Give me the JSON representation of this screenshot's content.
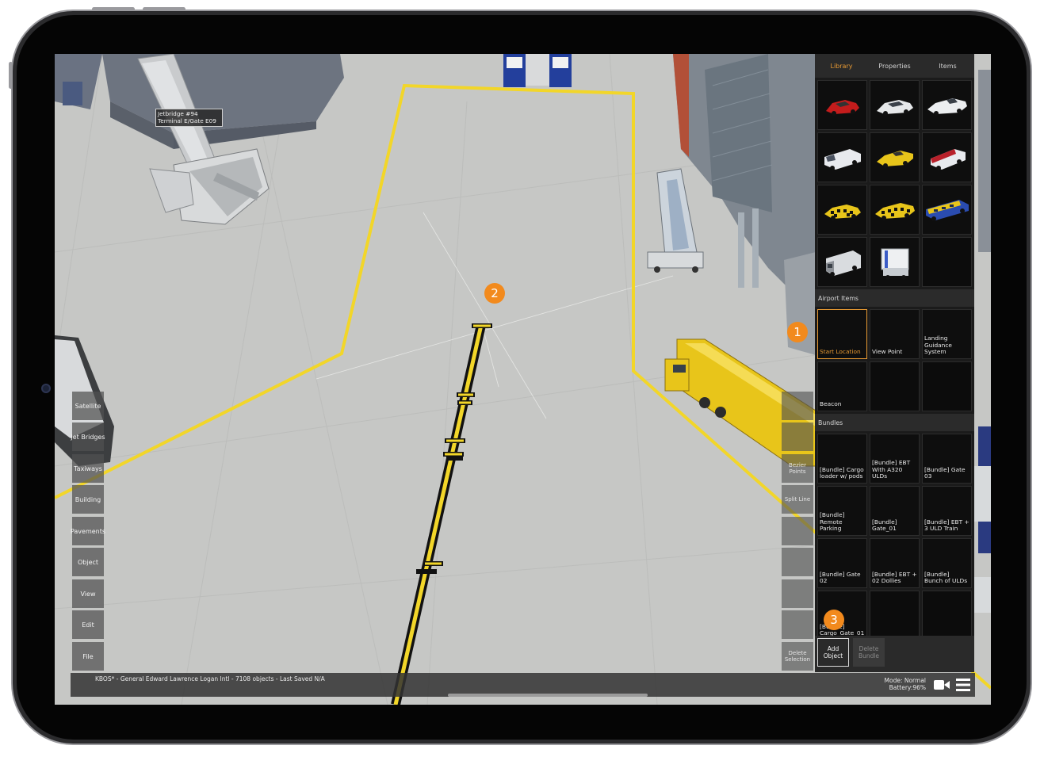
{
  "app": {
    "jetbridge_label": [
      "Jetbridge #94",
      "Terminal E/Gate E09"
    ]
  },
  "panel": {
    "tabs": [
      {
        "label": "Library",
        "active": true
      },
      {
        "label": "Properties",
        "active": false
      },
      {
        "label": "Items",
        "active": false
      }
    ],
    "vehicles": [
      {
        "icon": "red-car-icon"
      },
      {
        "icon": "white-sedan-icon"
      },
      {
        "icon": "white-pickup-icon"
      },
      {
        "icon": "white-van-icon"
      },
      {
        "icon": "yellow-pickup-icon"
      },
      {
        "icon": "red-van-icon"
      },
      {
        "icon": "checkered-car-icon"
      },
      {
        "icon": "checkered-pickup-icon"
      },
      {
        "icon": "bus-icon"
      },
      {
        "icon": "white-truck-icon"
      },
      {
        "icon": "catering-truck-icon"
      }
    ],
    "airport_items_header": "Airport Items",
    "airport_items": [
      {
        "label": "Start Location",
        "selected": true
      },
      {
        "label": "View Point",
        "selected": false
      },
      {
        "label": "Landing Guidance System",
        "selected": false
      },
      {
        "label": "Beacon",
        "selected": false
      }
    ],
    "bundles_header": "Bundles",
    "bundles": [
      {
        "label": "[Bundle] Cargo loader w/ pods"
      },
      {
        "label": "[Bundle] EBT With A320 ULDs"
      },
      {
        "label": "[Bundle] Gate 03"
      },
      {
        "label": "[Bundle] Remote Parking"
      },
      {
        "label": "[Bundle] Gate_01"
      },
      {
        "label": "[Bundle] EBT + 3 ULD Train"
      },
      {
        "label": "[Bundle] Gate 02"
      },
      {
        "label": "[Bundle] EBT + 02 Dollies"
      },
      {
        "label": "[Bundle] Bunch of ULDs"
      },
      {
        "label": "[Bundle] Cargo_Gate_01"
      }
    ],
    "add_object": "Add Object",
    "delete_bundle": "Delete Bundle"
  },
  "left_nav": [
    "Satellite",
    "Jet Bridges",
    "Taxiways",
    "Building",
    "Pavements",
    "Object",
    "View",
    "Edit",
    "File"
  ],
  "right_tools": [
    "",
    "",
    "Bezier Points",
    "Split Line",
    "",
    "",
    "",
    "",
    "Delete Selection"
  ],
  "status": {
    "text": "KBOS* - General Edward Lawrence Logan Intl - 7108 objects - Last Saved N/A",
    "mode": "Mode: Normal",
    "battery": "Battery:96%"
  },
  "callouts": [
    "1",
    "2",
    "3"
  ],
  "colors": {
    "accent": "#e89a33",
    "taxi_line": "#f2d629",
    "callout": "#f28a1d",
    "panel_bg": "#1b1b1b"
  }
}
